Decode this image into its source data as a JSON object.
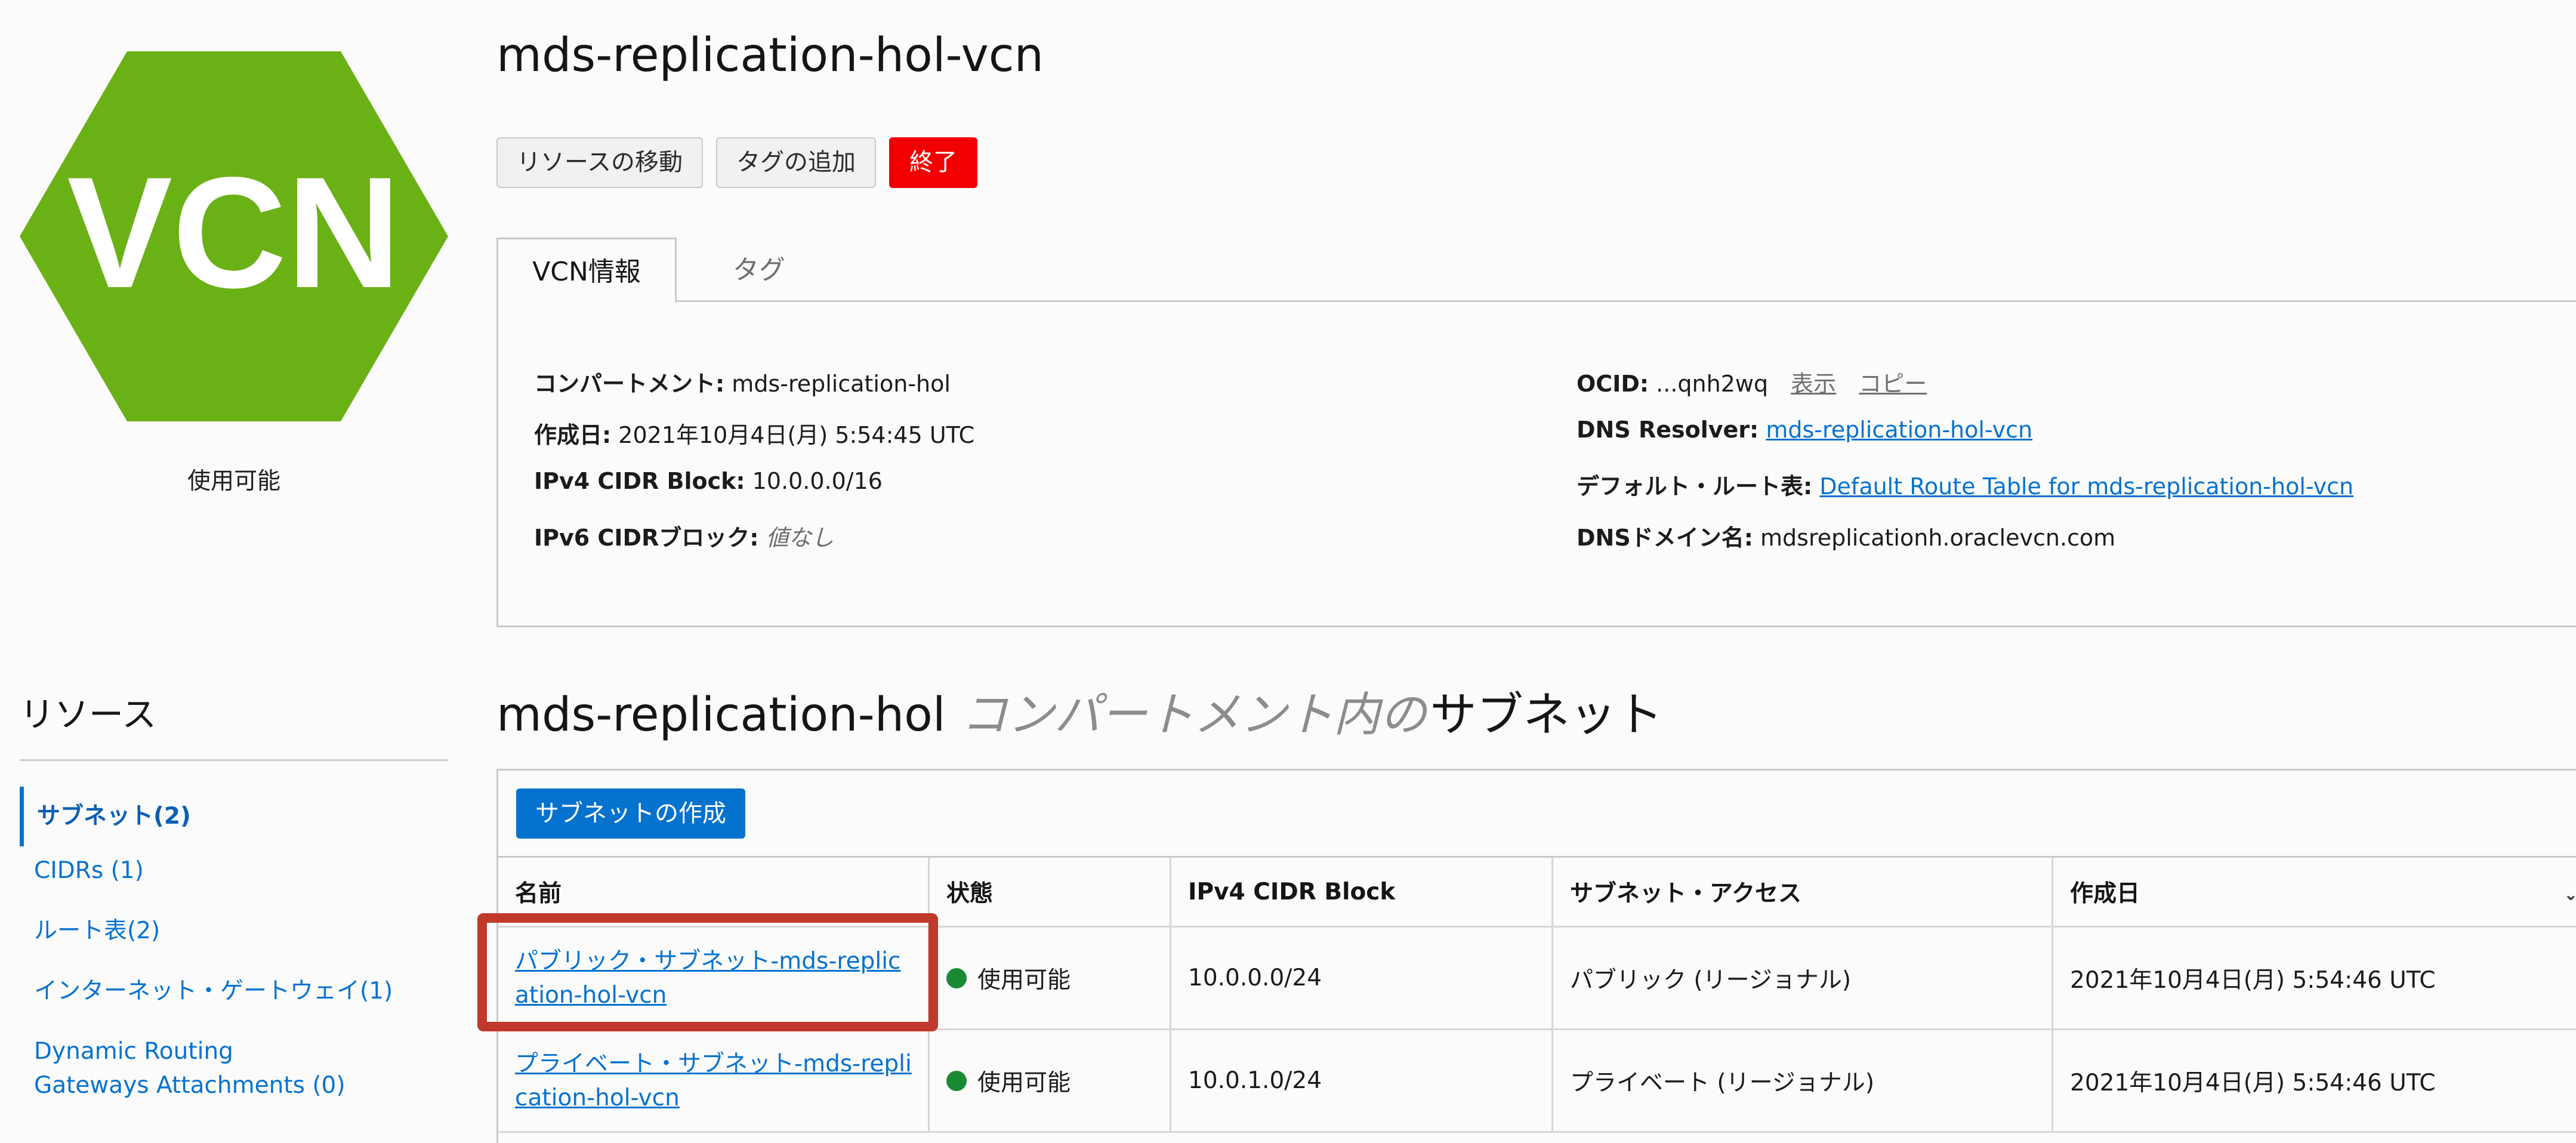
{
  "vcn_badge": {
    "text": "VCN",
    "color": "#6ab115"
  },
  "vcn_status": "使用可能",
  "page_title": "mds-replication-hol-vcn",
  "actions": {
    "move_resource": "リソースの移動",
    "add_tag": "タグの追加",
    "terminate": "終了"
  },
  "tabs": {
    "vcn_info": "VCN情報",
    "tags": "タグ"
  },
  "info": {
    "compartment_label": "コンパートメント:",
    "compartment_value": "mds-replication-hol",
    "created_label": "作成日:",
    "created_value": "2021年10月4日(月) 5:54:45 UTC",
    "ipv4_label": "IPv4 CIDR Block:",
    "ipv4_value": "10.0.0.0/16",
    "ipv6_label": "IPv6 CIDRブロック:",
    "ipv6_value": "値なし",
    "ocid_label": "OCID:",
    "ocid_value": "...qnh2wq",
    "ocid_show": "表示",
    "ocid_copy": "コピー",
    "dns_resolver_label": "DNS Resolver:",
    "dns_resolver_value": "mds-replication-hol-vcn",
    "default_route_label": "デフォルト・ルート表:",
    "default_route_value": "Default Route Table for mds-replication-hol-vcn",
    "dns_domain_label": "DNSドメイン名:",
    "dns_domain_value": "mdsreplicationh.oraclevcn.com"
  },
  "resources": {
    "heading": "リソース",
    "items": [
      {
        "label": "サブネット(2)"
      },
      {
        "label": "CIDRs (1)"
      },
      {
        "label": "ルート表(2)"
      },
      {
        "label": "インターネット・ゲートウェイ(1)"
      },
      {
        "label": "Dynamic Routing Gateways Attachments (0)"
      }
    ]
  },
  "subnets_section": {
    "compartment": "mds-replication-hol",
    "in_compartment": "コンパートメント内の",
    "subnets_word": "サブネット",
    "create_button": "サブネットの作成",
    "columns": [
      "名前",
      "状態",
      "IPv4 CIDR Block",
      "サブネット・アクセス",
      "作成日"
    ],
    "rows": [
      {
        "name_line1": "パブリック・サブネット-mds-replic",
        "name_line2": "ation-hol-vcn",
        "state": "使用可能",
        "cidr": "10.0.0.0/24",
        "access": "パブリック (リージョナル)",
        "created": "2021年10月4日(月) 5:54:46 UTC"
      },
      {
        "name_line1": "プライベート・サブネット-mds-repli",
        "name_line2": "cation-hol-vcn",
        "state": "使用可能",
        "cidr": "10.0.1.0/24",
        "access": "プライベート (リージョナル)",
        "created": "2021年10月4日(月) 5:54:46 UTC"
      }
    ]
  },
  "colors": {
    "link": "#0572ce",
    "danger": "#f20000",
    "available": "#1a8a34",
    "highlight": "#c0392b"
  }
}
